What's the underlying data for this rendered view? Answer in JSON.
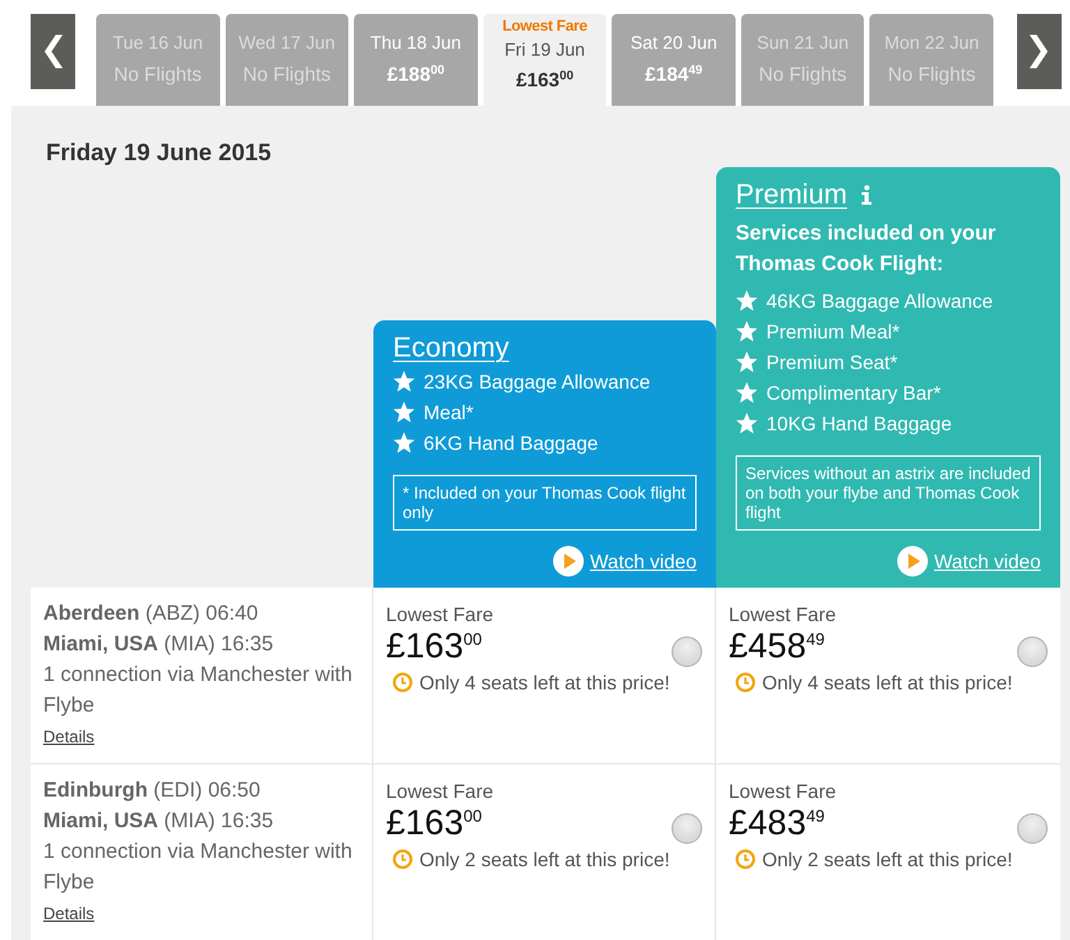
{
  "date_tabs": [
    {
      "date": "Tue 16 Jun",
      "fare": "No Flights",
      "available": false,
      "selected": false
    },
    {
      "date": "Wed 17 Jun",
      "fare": "No Flights",
      "available": false,
      "selected": false
    },
    {
      "date": "Thu 18 Jun",
      "fare": "£188$^{00}$",
      "available": true,
      "selected": false
    },
    {
      "badge": "Lowest Fare",
      "date": "Fri 19 Jun",
      "fare": "£163$^{00}$",
      "available": true,
      "selected": true
    },
    {
      "date": "Sat 20 Jun",
      "fare": "£184$^{49}$",
      "available": true,
      "selected": false
    },
    {
      "date": "Sun 21 Jun",
      "fare": "No Flights",
      "available": false,
      "selected": false
    },
    {
      "date": "Mon 22 Jun",
      "fare": "No Flights",
      "available": false,
      "selected": false
    }
  ],
  "heading": "Friday 19 June 2015",
  "plans": [
    {
      "kind": "economy",
      "title": "Economy",
      "features": [
        "23KG Baggage Allowance",
        "Meal*",
        "6KG Hand Baggage"
      ],
      "note": "* Included on your Thomas Cook flight only",
      "video_link": "Watch video"
    },
    {
      "kind": "premium",
      "title": "Premium",
      "subtitle": "Services included on your Thomas Cook Flight:",
      "features": [
        "46KG Baggage Allowance",
        "Premium Meal*",
        "Premium Seat*",
        "Complimentary Bar*",
        "10KG Hand Baggage"
      ],
      "note": "Services without an astrix are included on both your flybe and Thomas Cook flight",
      "video_link": "Watch video"
    }
  ],
  "flights": [
    {
      "departure": "**Aberdeen** (ABZ) 06:40",
      "arrival": "**Miami, USA** (MIA) 16:35",
      "connection": "1 connection via Manchester with Flybe",
      "details_link": "Details",
      "fares": [
        {
          "label": "Lowest Fare",
          "price": "£163$^{00}$",
          "availability": "Only 4 seats left at this price!",
          "selected": false
        },
        {
          "label": "Lowest Fare",
          "price": "£458$^{49}$",
          "availability": "Only 4 seats left at this price!",
          "selected": false
        }
      ]
    },
    {
      "departure": "**Edinburgh** (EDI) 06:50",
      "arrival": "**Miami, USA** (MIA) 16:35",
      "connection": "1 connection via Manchester with Flybe",
      "details_link": "Details",
      "fares": [
        {
          "label": "Lowest Fare",
          "price": "£163$^{00}$",
          "availability": "Only 2 seats left at this price!",
          "selected": false
        },
        {
          "label": "Lowest Fare",
          "price": "£483$^{49}$",
          "availability": "Only 2 seats left at this price!",
          "selected": false
        }
      ]
    }
  ]
}
